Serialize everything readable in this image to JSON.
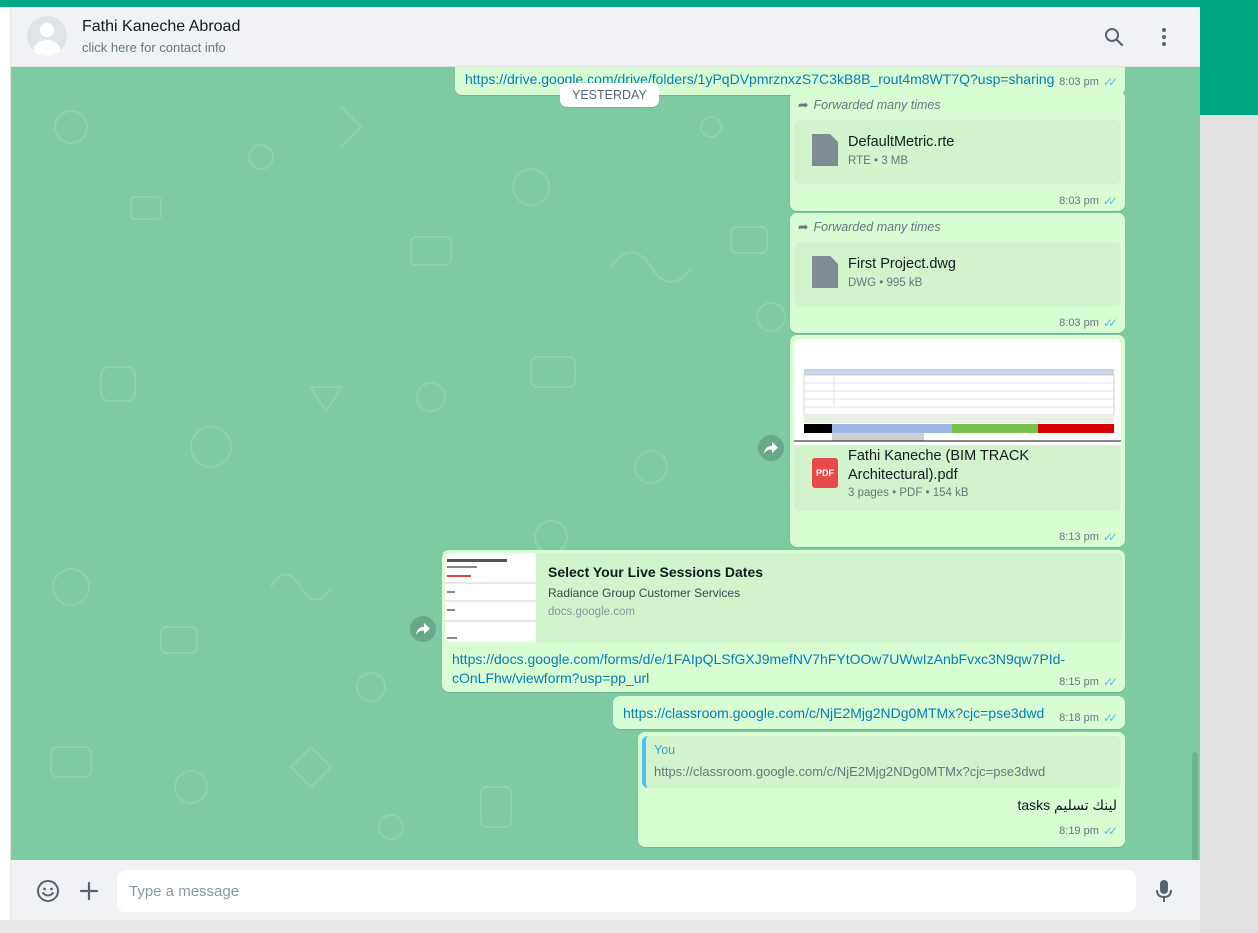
{
  "header": {
    "contact_name": "Fathi Kaneche Abroad",
    "contact_subtitle": "click here for contact info",
    "icons": [
      "search-icon",
      "menu-icon"
    ]
  },
  "chat": {
    "date_divider": "YESTERDAY",
    "messages": [
      {
        "type": "link",
        "text": "https://drive.google.com/drive/folders/1yPqDVpmrznxzS7C3kB8B_rout4m8WT7Q?usp=sharing",
        "time": "8:03 pm"
      },
      {
        "type": "document",
        "forwarded": "Forwarded many times",
        "file_name": "DefaultMetric.rte",
        "meta": "RTE • 3 MB",
        "time": "8:03 pm"
      },
      {
        "type": "document",
        "forwarded": "Forwarded many times",
        "file_name": "First Project.dwg",
        "meta": "DWG • 995 kB",
        "time": "8:03 pm"
      },
      {
        "type": "pdf",
        "badge": "PDF",
        "file_name": "Fathi Kaneche (BIM TRACK Architectural).pdf",
        "meta": "3 pages • PDF • 154 kB",
        "time": "8:13 pm"
      },
      {
        "type": "link-preview",
        "preview_title": "Select Your Live Sessions Dates",
        "preview_desc": "Radiance Group Customer Services",
        "preview_domain": "docs.google.com",
        "text": "https://docs.google.com/forms/d/e/1FAIpQLSfGXJ9mefNV7hFYtOOw7UWwIzAnbFvxc3N9qw7PId-cOnLFhw/viewform?usp=pp_url",
        "time": "8:15 pm"
      },
      {
        "type": "link",
        "text": "https://classroom.google.com/c/NjE2Mjg2NDg0MTMx?cjc=pse3dwd",
        "time": "8:18 pm"
      },
      {
        "type": "reply",
        "quote_author": "You",
        "quote_text": "https://classroom.google.com/c/NjE2Mjg2NDg0MTMx?cjc=pse3dwd",
        "text": "لينك تسليم tasks",
        "time": "8:19 pm"
      }
    ]
  },
  "footer": {
    "placeholder": "Type a message",
    "icons": [
      "emoji-icon",
      "plus-icon",
      "microphone-icon"
    ]
  },
  "colors": {
    "accent": "#00a884",
    "chat_bg": "#7ecaa3",
    "bubble_out": "#d9fdd3",
    "link": "#027eb5",
    "read_ticks": "#53bdeb"
  }
}
